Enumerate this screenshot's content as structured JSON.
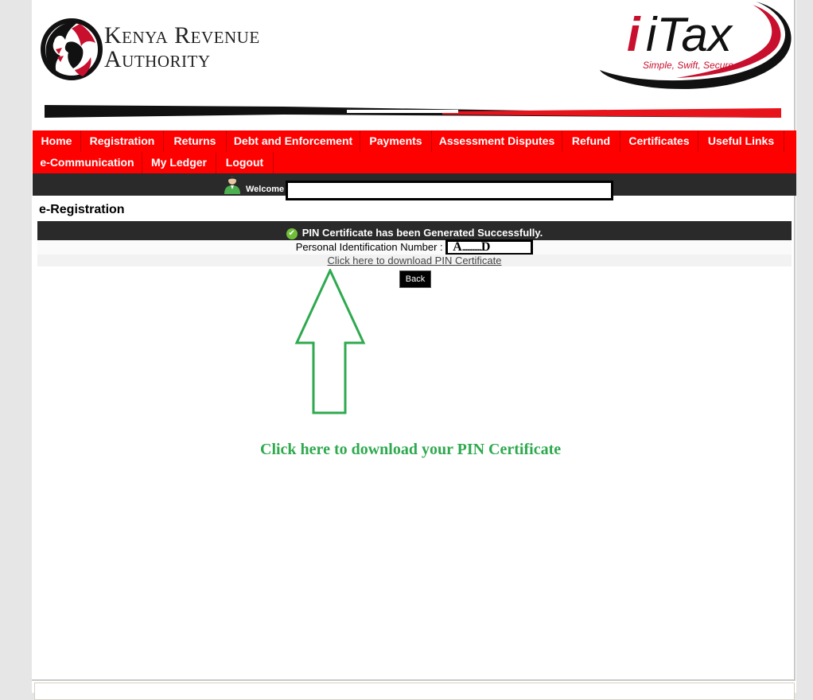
{
  "header": {
    "org_line1": "Kenya Revenue",
    "org_line2": "Authority",
    "itax_brand": "iTax",
    "tagline": "Simple, Swift, Secure"
  },
  "nav": {
    "row1": [
      "Home",
      "Registration",
      "Returns",
      "Debt and Enforcement",
      "Payments",
      "Assessment Disputes",
      "Refund",
      "Certificates",
      "Useful Links"
    ],
    "row2": [
      "e-Communication",
      "My Ledger",
      "Logout"
    ]
  },
  "welcome": {
    "label": "Welcome"
  },
  "content": {
    "section_title": "e-Registration",
    "success_message": "PIN Certificate has been Generated Successfully.",
    "pin_label": "Personal Identification Number :",
    "pin_start": "A",
    "pin_masked": "................",
    "pin_end": "D",
    "download_link": "Click here to download PIN Certificate",
    "back_button": "Back"
  },
  "annotation": {
    "text": "Click here to download your PIN Certificate",
    "color": "#2ea94e"
  },
  "colors": {
    "nav_red": "#ff0000",
    "dark_bar": "#2a2a2a",
    "brand_red": "#c8102e"
  }
}
